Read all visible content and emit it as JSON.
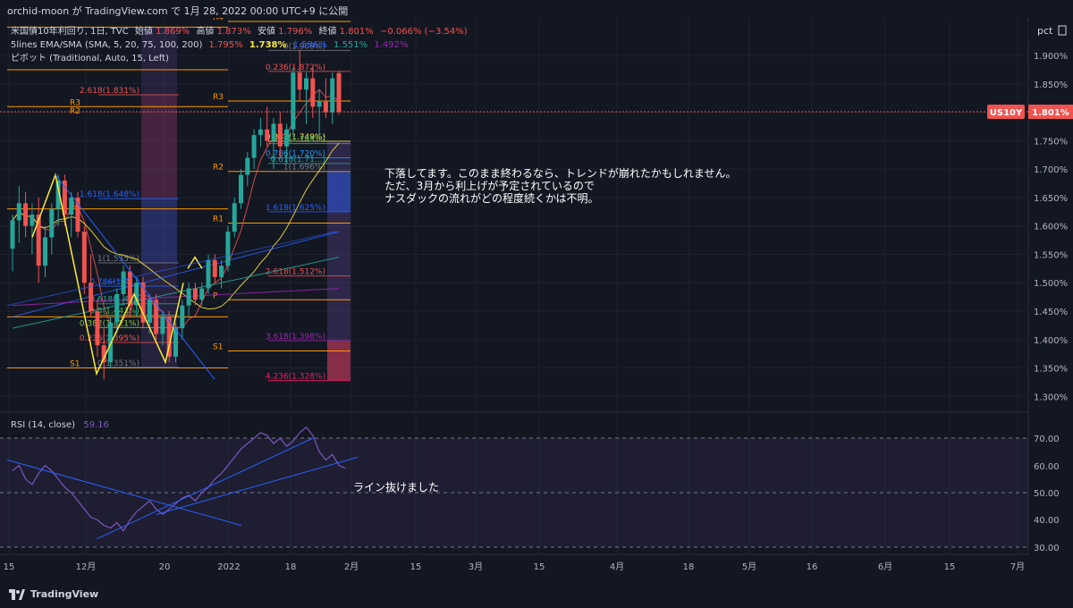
{
  "header": {
    "publish_line": "orchid-moon が TradingView.com で 1月 28, 2022 00:00 UTC+9 に公開"
  },
  "legend": {
    "symbol_line": "米国債10年利回り, 1日, TVC",
    "open_label": "始値",
    "open_value": "1.869%",
    "high_label": "高値",
    "high_value": "1.873%",
    "low_label": "安値",
    "low_value": "1.796%",
    "close_label": "終値",
    "close_value": "1.801%",
    "change_value": "−0.066% (−3.54%)",
    "ma_line": "5lines EMA/SMA (SMA, 5, 20, 75, 100, 200)",
    "ma_values": [
      "1.795%",
      "1.738%",
      "1.586%",
      "1.551%",
      "1.492%"
    ],
    "ma_colors": [
      "#f05350",
      "#ffeb3b",
      "#2962ff",
      "#26a69a",
      "#9c27b0"
    ],
    "pivot_line": "ピボット (Traditional, Auto, 15, Left)"
  },
  "price_axis": {
    "unit_label": "pct",
    "ticks": [
      "1.900%",
      "1.850%",
      "1.800%",
      "1.750%",
      "1.700%",
      "1.650%",
      "1.600%",
      "1.550%",
      "1.500%",
      "1.450%",
      "1.400%",
      "1.350%",
      "1.300%"
    ],
    "current_symbol": "US10Y",
    "current_price": "1.801%",
    "current_color": "#f05350"
  },
  "rsi": {
    "title": "RSI (14, close)",
    "value": "59.16",
    "ticks": [
      "70.00",
      "60.00",
      "50.00",
      "40.00",
      "30.00"
    ],
    "line_color": "#7e57c2"
  },
  "time_axis": {
    "ticks": [
      "15",
      "12月",
      "20",
      "2022",
      "18",
      "2月",
      "15",
      "3月",
      "15",
      "4月",
      "18",
      "5月",
      "16",
      "6月",
      "15",
      "7月"
    ]
  },
  "pivot_labels": [
    "R4",
    "R3",
    "R2",
    "R1",
    "P",
    "S1",
    "R3",
    "R2",
    "R1",
    "P",
    "S1"
  ],
  "fib_labels_left": [
    "2.618(1.831%)",
    "1.618(1.648%)",
    "1(1.535%)",
    "0.786(1.4...)",
    "0.618(1.4...)",
    "0.5(1.443%)",
    "0.382(1.421%)",
    "0.236(1.395%)",
    "0(1.351%)"
  ],
  "fib_labels_right": [
    "0(1.909%)",
    "0.236(1.872%)",
    "0.382(1.749%)",
    "0.5(1.745%)",
    "0.618(1.71...)",
    "0.786(1.720%)",
    "1(1.696%)",
    "1.618(1.625%)",
    "2.618(1.512%)",
    "3.618(1.398%)",
    "4.236(1.328%)"
  ],
  "annotations": {
    "main_note_lines": [
      "下落してます。このまま終わるなら、トレンドが崩れたかもしれません。",
      "ただ、3月から利上げが予定されているので",
      "ナスダックの流れがどの程度続くかは不明。"
    ],
    "rsi_note": "ライン抜けました"
  },
  "footer": {
    "brand": "TradingView"
  },
  "chart_data": {
    "type": "candlestick",
    "title": "米国債10年利回り, 1日, TVC",
    "ylim": [
      1.28,
      1.96
    ],
    "candles": [
      {
        "o": 1.56,
        "h": 1.62,
        "l": 1.52,
        "c": 1.61
      },
      {
        "o": 1.61,
        "h": 1.67,
        "l": 1.57,
        "c": 1.64
      },
      {
        "o": 1.64,
        "h": 1.66,
        "l": 1.58,
        "c": 1.6
      },
      {
        "o": 1.6,
        "h": 1.64,
        "l": 1.55,
        "c": 1.62
      },
      {
        "o": 1.62,
        "h": 1.65,
        "l": 1.5,
        "c": 1.53
      },
      {
        "o": 1.53,
        "h": 1.6,
        "l": 1.51,
        "c": 1.58
      },
      {
        "o": 1.58,
        "h": 1.64,
        "l": 1.55,
        "c": 1.63
      },
      {
        "o": 1.63,
        "h": 1.69,
        "l": 1.6,
        "c": 1.68
      },
      {
        "o": 1.68,
        "h": 1.69,
        "l": 1.6,
        "c": 1.62
      },
      {
        "o": 1.62,
        "h": 1.66,
        "l": 1.58,
        "c": 1.65
      },
      {
        "o": 1.65,
        "h": 1.66,
        "l": 1.58,
        "c": 1.59
      },
      {
        "o": 1.59,
        "h": 1.6,
        "l": 1.48,
        "c": 1.5
      },
      {
        "o": 1.5,
        "h": 1.55,
        "l": 1.44,
        "c": 1.45
      },
      {
        "o": 1.45,
        "h": 1.47,
        "l": 1.37,
        "c": 1.39
      },
      {
        "o": 1.39,
        "h": 1.42,
        "l": 1.33,
        "c": 1.36
      },
      {
        "o": 1.36,
        "h": 1.44,
        "l": 1.35,
        "c": 1.43
      },
      {
        "o": 1.43,
        "h": 1.49,
        "l": 1.41,
        "c": 1.48
      },
      {
        "o": 1.48,
        "h": 1.53,
        "l": 1.46,
        "c": 1.52
      },
      {
        "o": 1.52,
        "h": 1.53,
        "l": 1.44,
        "c": 1.46
      },
      {
        "o": 1.46,
        "h": 1.51,
        "l": 1.44,
        "c": 1.5
      },
      {
        "o": 1.5,
        "h": 1.51,
        "l": 1.42,
        "c": 1.43
      },
      {
        "o": 1.43,
        "h": 1.48,
        "l": 1.41,
        "c": 1.47
      },
      {
        "o": 1.47,
        "h": 1.48,
        "l": 1.4,
        "c": 1.41
      },
      {
        "o": 1.41,
        "h": 1.45,
        "l": 1.39,
        "c": 1.44
      },
      {
        "o": 1.44,
        "h": 1.45,
        "l": 1.36,
        "c": 1.37
      },
      {
        "o": 1.37,
        "h": 1.43,
        "l": 1.36,
        "c": 1.42
      },
      {
        "o": 1.42,
        "h": 1.47,
        "l": 1.4,
        "c": 1.46
      },
      {
        "o": 1.46,
        "h": 1.5,
        "l": 1.44,
        "c": 1.49
      },
      {
        "o": 1.49,
        "h": 1.5,
        "l": 1.46,
        "c": 1.47
      },
      {
        "o": 1.47,
        "h": 1.5,
        "l": 1.46,
        "c": 1.49
      },
      {
        "o": 1.49,
        "h": 1.55,
        "l": 1.48,
        "c": 1.54
      },
      {
        "o": 1.54,
        "h": 1.55,
        "l": 1.5,
        "c": 1.51
      },
      {
        "o": 1.51,
        "h": 1.54,
        "l": 1.49,
        "c": 1.53
      },
      {
        "o": 1.53,
        "h": 1.6,
        "l": 1.52,
        "c": 1.59
      },
      {
        "o": 1.59,
        "h": 1.65,
        "l": 1.58,
        "c": 1.64
      },
      {
        "o": 1.64,
        "h": 1.7,
        "l": 1.63,
        "c": 1.69
      },
      {
        "o": 1.69,
        "h": 1.73,
        "l": 1.67,
        "c": 1.72
      },
      {
        "o": 1.72,
        "h": 1.77,
        "l": 1.7,
        "c": 1.76
      },
      {
        "o": 1.76,
        "h": 1.79,
        "l": 1.74,
        "c": 1.77
      },
      {
        "o": 1.77,
        "h": 1.81,
        "l": 1.74,
        "c": 1.75
      },
      {
        "o": 1.75,
        "h": 1.79,
        "l": 1.7,
        "c": 1.78
      },
      {
        "o": 1.78,
        "h": 1.8,
        "l": 1.72,
        "c": 1.74
      },
      {
        "o": 1.74,
        "h": 1.78,
        "l": 1.71,
        "c": 1.77
      },
      {
        "o": 1.77,
        "h": 1.88,
        "l": 1.76,
        "c": 1.87
      },
      {
        "o": 1.87,
        "h": 1.91,
        "l": 1.82,
        "c": 1.84
      },
      {
        "o": 1.84,
        "h": 1.87,
        "l": 1.78,
        "c": 1.86
      },
      {
        "o": 1.86,
        "h": 1.88,
        "l": 1.79,
        "c": 1.81
      },
      {
        "o": 1.81,
        "h": 1.84,
        "l": 1.76,
        "c": 1.82
      },
      {
        "o": 1.82,
        "h": 1.86,
        "l": 1.79,
        "c": 1.8
      },
      {
        "o": 1.8,
        "h": 1.87,
        "l": 1.78,
        "c": 1.86
      },
      {
        "o": 1.869,
        "h": 1.873,
        "l": 1.796,
        "c": 1.801
      }
    ],
    "rsi_values": [
      58,
      60,
      55,
      53,
      57,
      60,
      58,
      55,
      52,
      50,
      47,
      44,
      41,
      40,
      38,
      37,
      39,
      36,
      40,
      43,
      45,
      47,
      44,
      42,
      44,
      46,
      48,
      49,
      47,
      50,
      52,
      55,
      57,
      60,
      63,
      66,
      68,
      70,
      72,
      71,
      68,
      70,
      67,
      69,
      72,
      74,
      71,
      65,
      62,
      64,
      60,
      59
    ]
  }
}
